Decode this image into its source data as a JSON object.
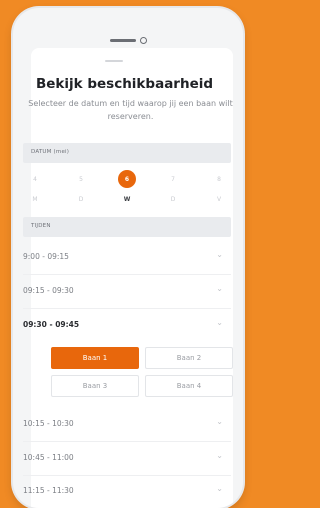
{
  "colors": {
    "background": "#f08a24",
    "accent": "#e8670c"
  },
  "title": "Bekijk beschikbaarheid",
  "subtitle": "Selecteer de datum en tijd waarop jij een baan wilt reserveren.",
  "date_section": {
    "label": "DATUM (mei)",
    "days": [
      {
        "num": "4",
        "weekday": "M"
      },
      {
        "num": "5",
        "weekday": "D"
      },
      {
        "num": "6",
        "weekday": "W",
        "selected": true
      },
      {
        "num": "7",
        "weekday": "D"
      },
      {
        "num": "8",
        "weekday": "V"
      }
    ]
  },
  "times_section": {
    "label": "TIJDEN",
    "slots": [
      {
        "time": "9:00 - 09:15"
      },
      {
        "time": "09:15 - 09:30"
      },
      {
        "time": "09:30 - 09:45",
        "expanded": true
      },
      {
        "time": "10:15 - 10:30"
      },
      {
        "time": "10:45 - 11:00"
      },
      {
        "time": "11:15 - 11:30"
      }
    ],
    "courts": [
      "Baan 1",
      "Baan 2",
      "Baan 3",
      "Baan 4"
    ],
    "selected_court": "Baan 1"
  },
  "icons": {
    "chevron": "chevron-down-icon"
  }
}
